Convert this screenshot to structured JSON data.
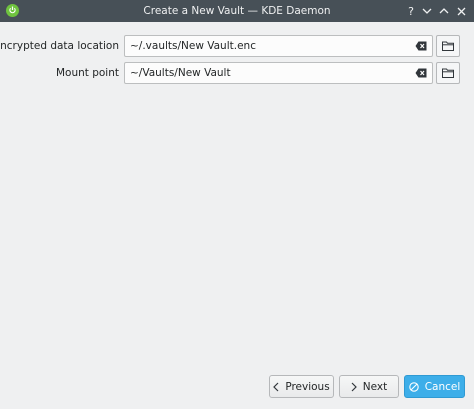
{
  "window": {
    "title": "Create a New Vault — KDE Daemon",
    "help_glyph": "?",
    "minimize_glyph": "⌄",
    "maximize_glyph": "⌃",
    "close_glyph": "✕"
  },
  "form": {
    "encrypted_location": {
      "label": "Encrypted data location",
      "value": "~/.vaults/New Vault.enc"
    },
    "mount_point": {
      "label": "Mount point",
      "value": "~/Vaults/New Vault"
    }
  },
  "buttons": {
    "previous": "Previous",
    "next": "Next",
    "cancel": "Cancel"
  },
  "colors": {
    "titlebar": "#475057",
    "window_bg": "#eff0f1",
    "accent": "#3daee9"
  }
}
